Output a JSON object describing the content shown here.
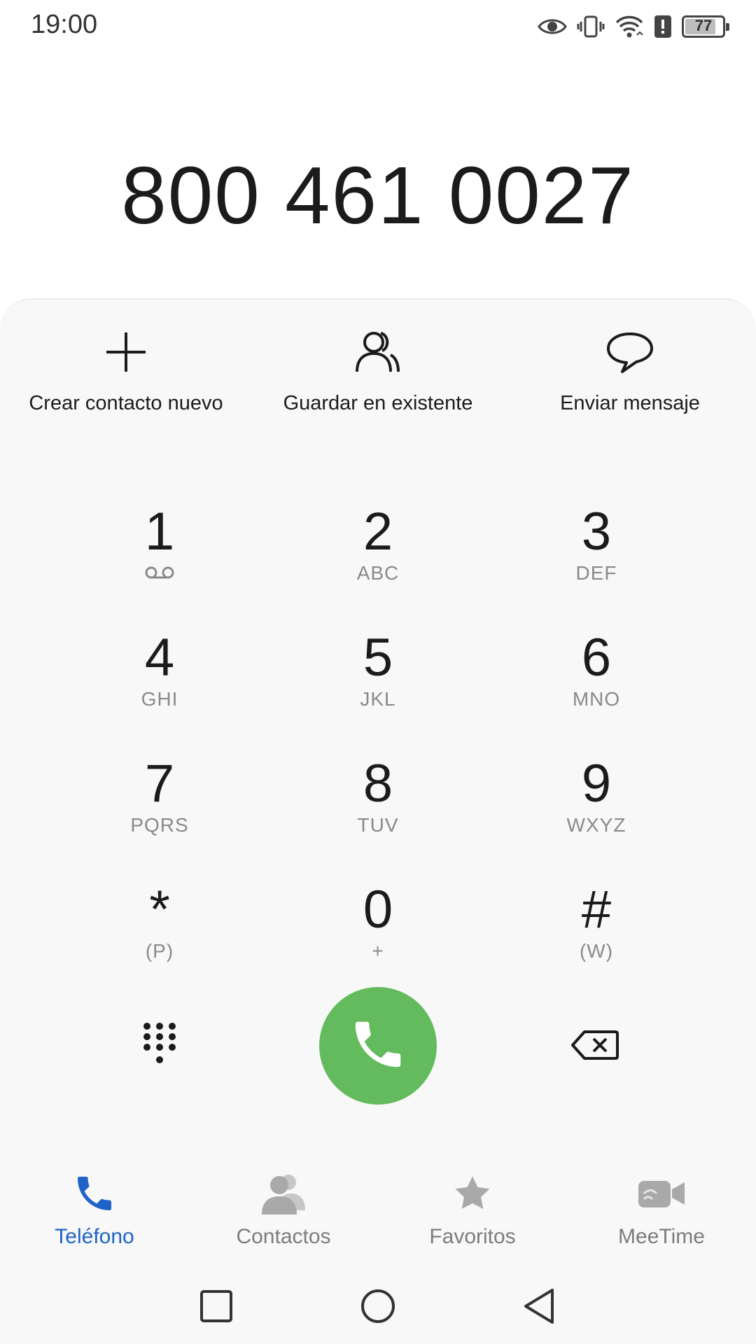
{
  "status_bar": {
    "time": "19:00",
    "battery_level": "77",
    "icons": [
      "eye-icon",
      "vibrate-icon",
      "wifi-icon",
      "alert-icon",
      "battery-icon"
    ]
  },
  "dialer": {
    "number": "800 461 0027"
  },
  "actions": [
    {
      "label": "Crear contacto nuevo",
      "icon": "plus-icon"
    },
    {
      "label": "Guardar en existente",
      "icon": "person-icon"
    },
    {
      "label": "Enviar mensaje",
      "icon": "message-bubble-icon"
    }
  ],
  "keypad": [
    {
      "digit": "1",
      "sub": ""
    },
    {
      "digit": "2",
      "sub": "ABC"
    },
    {
      "digit": "3",
      "sub": "DEF"
    },
    {
      "digit": "4",
      "sub": "GHI"
    },
    {
      "digit": "5",
      "sub": "JKL"
    },
    {
      "digit": "6",
      "sub": "MNO"
    },
    {
      "digit": "7",
      "sub": "PQRS"
    },
    {
      "digit": "8",
      "sub": "TUV"
    },
    {
      "digit": "9",
      "sub": "WXYZ"
    },
    {
      "digit": "*",
      "sub": "(P)"
    },
    {
      "digit": "0",
      "sub": "+"
    },
    {
      "digit": "#",
      "sub": "(W)"
    }
  ],
  "nav": {
    "telefono": "Teléfono",
    "contactos": "Contactos",
    "favoritos": "Favoritos",
    "meetime": "MeeTime"
  },
  "colors": {
    "accent": "#1e63c8",
    "call": "#63bb5e",
    "panel_bg": "#f8f8f8",
    "inactive": "#7c7c7c"
  }
}
